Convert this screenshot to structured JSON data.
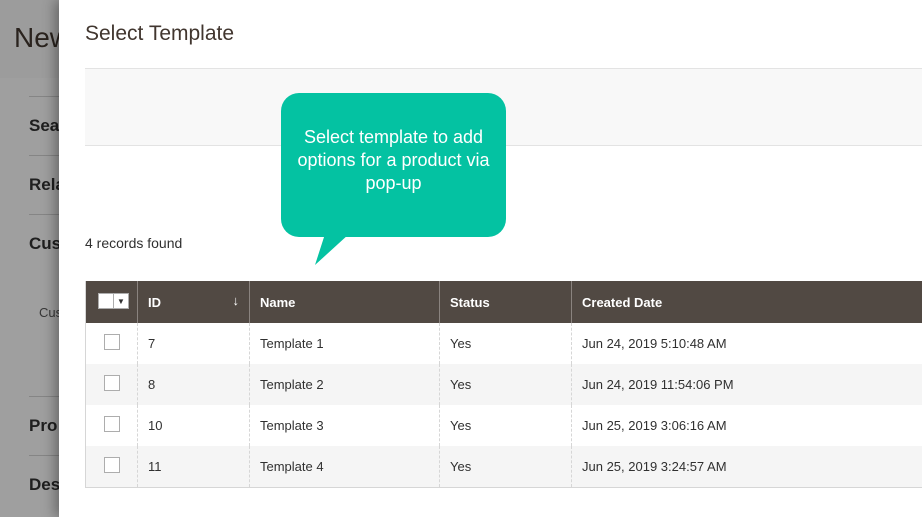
{
  "background": {
    "page_title": "New",
    "sections": [
      "Sea",
      "Rela",
      "Cus",
      "Pro",
      "Des"
    ],
    "sub_label": "Cus"
  },
  "modal": {
    "title": "Select Template",
    "records_found": "4 records found"
  },
  "callout": {
    "text": "Select template to add options for a product via pop-up",
    "color": "#04c2a2"
  },
  "grid": {
    "columns": [
      "ID",
      "Name",
      "Status",
      "Created Date"
    ],
    "sort_indicator": "↓",
    "rows": [
      {
        "id": "7",
        "name": "Template 1",
        "status": "Yes",
        "created": "Jun 24, 2019 5:10:48 AM"
      },
      {
        "id": "8",
        "name": "Template 2",
        "status": "Yes",
        "created": "Jun 24, 2019 11:54:06 PM"
      },
      {
        "id": "10",
        "name": "Template 3",
        "status": "Yes",
        "created": "Jun 25, 2019 3:06:16 AM"
      },
      {
        "id": "11",
        "name": "Template 4",
        "status": "Yes",
        "created": "Jun 25, 2019 3:24:57 AM"
      }
    ],
    "header_color": "#514943"
  }
}
